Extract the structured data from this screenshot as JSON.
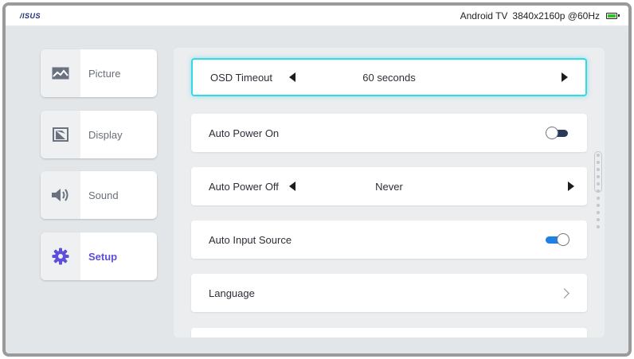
{
  "header": {
    "logo": "/ISUS",
    "device": "Android TV",
    "resolution": "3840x2160p @60Hz"
  },
  "sidebar": {
    "items": [
      {
        "label": "Picture",
        "icon": "picture-icon"
      },
      {
        "label": "Display",
        "icon": "display-icon"
      },
      {
        "label": "Sound",
        "icon": "speaker-icon"
      },
      {
        "label": "Setup",
        "icon": "gear-icon",
        "active": true
      }
    ],
    "active_color": "#5d4fd8"
  },
  "settings": {
    "osd_timeout": {
      "label": "OSD Timeout",
      "value": "60 seconds"
    },
    "auto_power_on": {
      "label": "Auto Power On",
      "state": "off"
    },
    "auto_power_off": {
      "label": "Auto Power Off",
      "value": "Never"
    },
    "auto_input_source": {
      "label": "Auto Input Source",
      "state": "on"
    },
    "language": {
      "label": "Language"
    }
  },
  "colors": {
    "focus_ring": "#34d9e6",
    "toggle_on": "#1e7fe6",
    "battery": "#2dc12d"
  }
}
